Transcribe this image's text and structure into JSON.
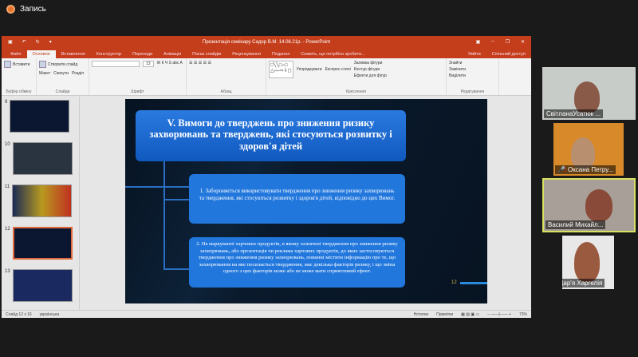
{
  "recording": {
    "label": "Запись"
  },
  "ppt": {
    "title": "Презентація семінару Садор В.М. 14.08.21р. - PowerPoint",
    "tabs": [
      "Файл",
      "Основне",
      "Вставлення",
      "Конструктор",
      "Переходи",
      "Анімація",
      "Показ слайдів",
      "Рецензування",
      "Подання"
    ],
    "tell_me": "Скажіть, що потрібно зробити...",
    "sign_in": "Увійти",
    "share": "Спільний доступ",
    "groups": [
      {
        "label": "Буфер обміну",
        "items": [
          "Вставити"
        ]
      },
      {
        "label": "Слайди",
        "items": [
          "Створити слайд",
          "Макет",
          "Скинути",
          "Розділ"
        ]
      },
      {
        "label": "Шрифт",
        "items": [
          "13"
        ]
      },
      {
        "label": "Абзац",
        "items": []
      },
      {
        "label": "Креслення",
        "items": [
          "Упорядкувати",
          "Експрес-стилі",
          "Заливка фігури",
          "Контур фігури",
          "Ефекти для фігур"
        ]
      },
      {
        "label": "Редагування",
        "items": [
          "Знайти",
          "Замінити",
          "Виділити"
        ]
      }
    ],
    "thumbnails": [
      {
        "n": "9"
      },
      {
        "n": "10"
      },
      {
        "n": "11"
      },
      {
        "n": "12"
      },
      {
        "n": "13"
      }
    ],
    "slide": {
      "title": "V. Вимоги до тверджень про зниження ризику захворювань та тверджень, які стосуються розвитку і здоров'я дітей",
      "point1": "1. Забороняється використовувати твердження про зниження ризику захворювань та твердження, які стосуються розвитку і здоров'я дітей, відповідно до цих Вимог.",
      "point2": "2. На маркуванні харчових продуктів, в якому зазначені твердження про зниження ризику захворювань, або презентація чи реклама харчових продуктів, до яких застосовуються твердження про зниження ризику захворювань, повинні містити інформацію про те, що захворювання на яке посилається твердження, має декілька факторів ризику, і що зміна одного з цих факторів може або не може мати сприятливий ефект.",
      "page": "12"
    },
    "status": {
      "slide": "Слайд 12 з 16",
      "lang": "українська",
      "notes": "Нотатки",
      "comments": "Примітки",
      "zoom": "73%"
    }
  },
  "participants": [
    {
      "name": "СвітланаУсатюк ...",
      "muted": false
    },
    {
      "name": "Оксана Петру...",
      "muted": true
    },
    {
      "name": "Василий Михайл...",
      "muted": false,
      "active": true
    },
    {
      "name": "Дар'я Харгелія",
      "muted": true
    }
  ]
}
